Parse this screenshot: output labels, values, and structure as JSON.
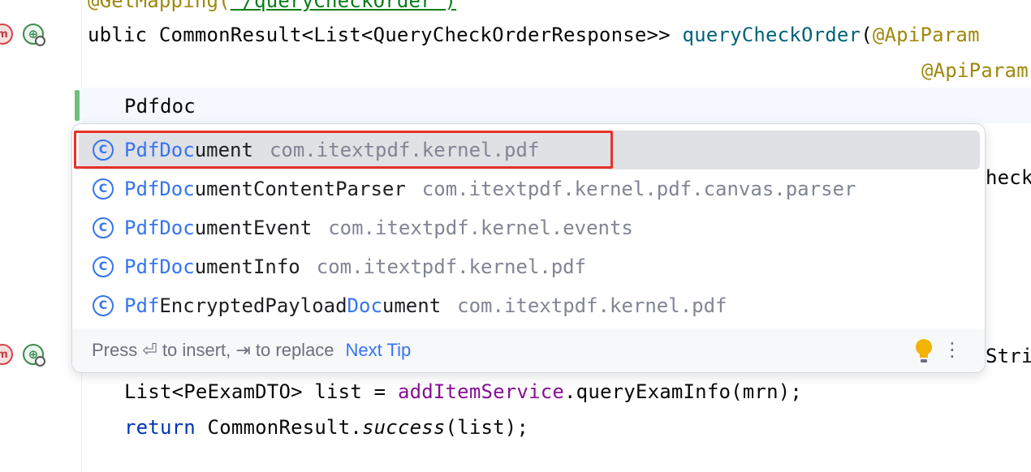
{
  "editor": {
    "line_annotation": "@GetMapping(",
    "line_annotation_tail": "\"/queryCheckOrder\")",
    "decl_prefix": "ublic CommonResult<List<QueryCheckOrderResponse>> ",
    "decl_method": "queryCheckOrder",
    "decl_paren": "(",
    "decl_param": "@ApiParam",
    "param2": "@ApiParam",
    "typed": "Pdfdoc",
    "right_check": "heck",
    "right_stri": "Stri",
    "line_list_prefix": "List<PeExamDTO> list = ",
    "line_list_field": "addItemService",
    "line_list_suffix": ".queryExamInfo(mrn);",
    "return_kw": "return",
    "return_mid": " CommonResult.",
    "return_method": "success",
    "return_tail": "(list);"
  },
  "gutter_icons": [
    "mapping-icon",
    "web-endpoint-icon"
  ],
  "completion": {
    "items": [
      {
        "parts": [
          {
            "t": "PdfDoc",
            "h": true
          },
          {
            "t": "ument",
            "h": false
          }
        ],
        "package": "com.itextpdf.kernel.pdf",
        "selected": true
      },
      {
        "parts": [
          {
            "t": "PdfDoc",
            "h": true
          },
          {
            "t": "umentContentParser",
            "h": false
          }
        ],
        "package": "com.itextpdf.kernel.pdf.canvas.parser",
        "selected": false
      },
      {
        "parts": [
          {
            "t": "PdfDoc",
            "h": true
          },
          {
            "t": "umentEvent",
            "h": false
          }
        ],
        "package": "com.itextpdf.kernel.events",
        "selected": false
      },
      {
        "parts": [
          {
            "t": "PdfDoc",
            "h": true
          },
          {
            "t": "umentInfo",
            "h": false
          }
        ],
        "package": "com.itextpdf.kernel.pdf",
        "selected": false
      },
      {
        "parts": [
          {
            "t": "Pdf",
            "h": true
          },
          {
            "t": "EncryptedPayload",
            "h": false
          },
          {
            "t": "Doc",
            "h": true
          },
          {
            "t": "ument",
            "h": false
          }
        ],
        "package": "com.itextpdf.kernel.pdf",
        "selected": false
      }
    ],
    "class_icon_glyph": "C",
    "footer_hint": "Press ⏎ to insert, ⇥ to replace",
    "footer_link": "Next Tip",
    "menu_glyph": "⋮"
  },
  "colors": {
    "accent": "#3574f0",
    "selection": "#dfe1e5",
    "highlight_box": "#e8312a",
    "package_text": "#818594"
  }
}
